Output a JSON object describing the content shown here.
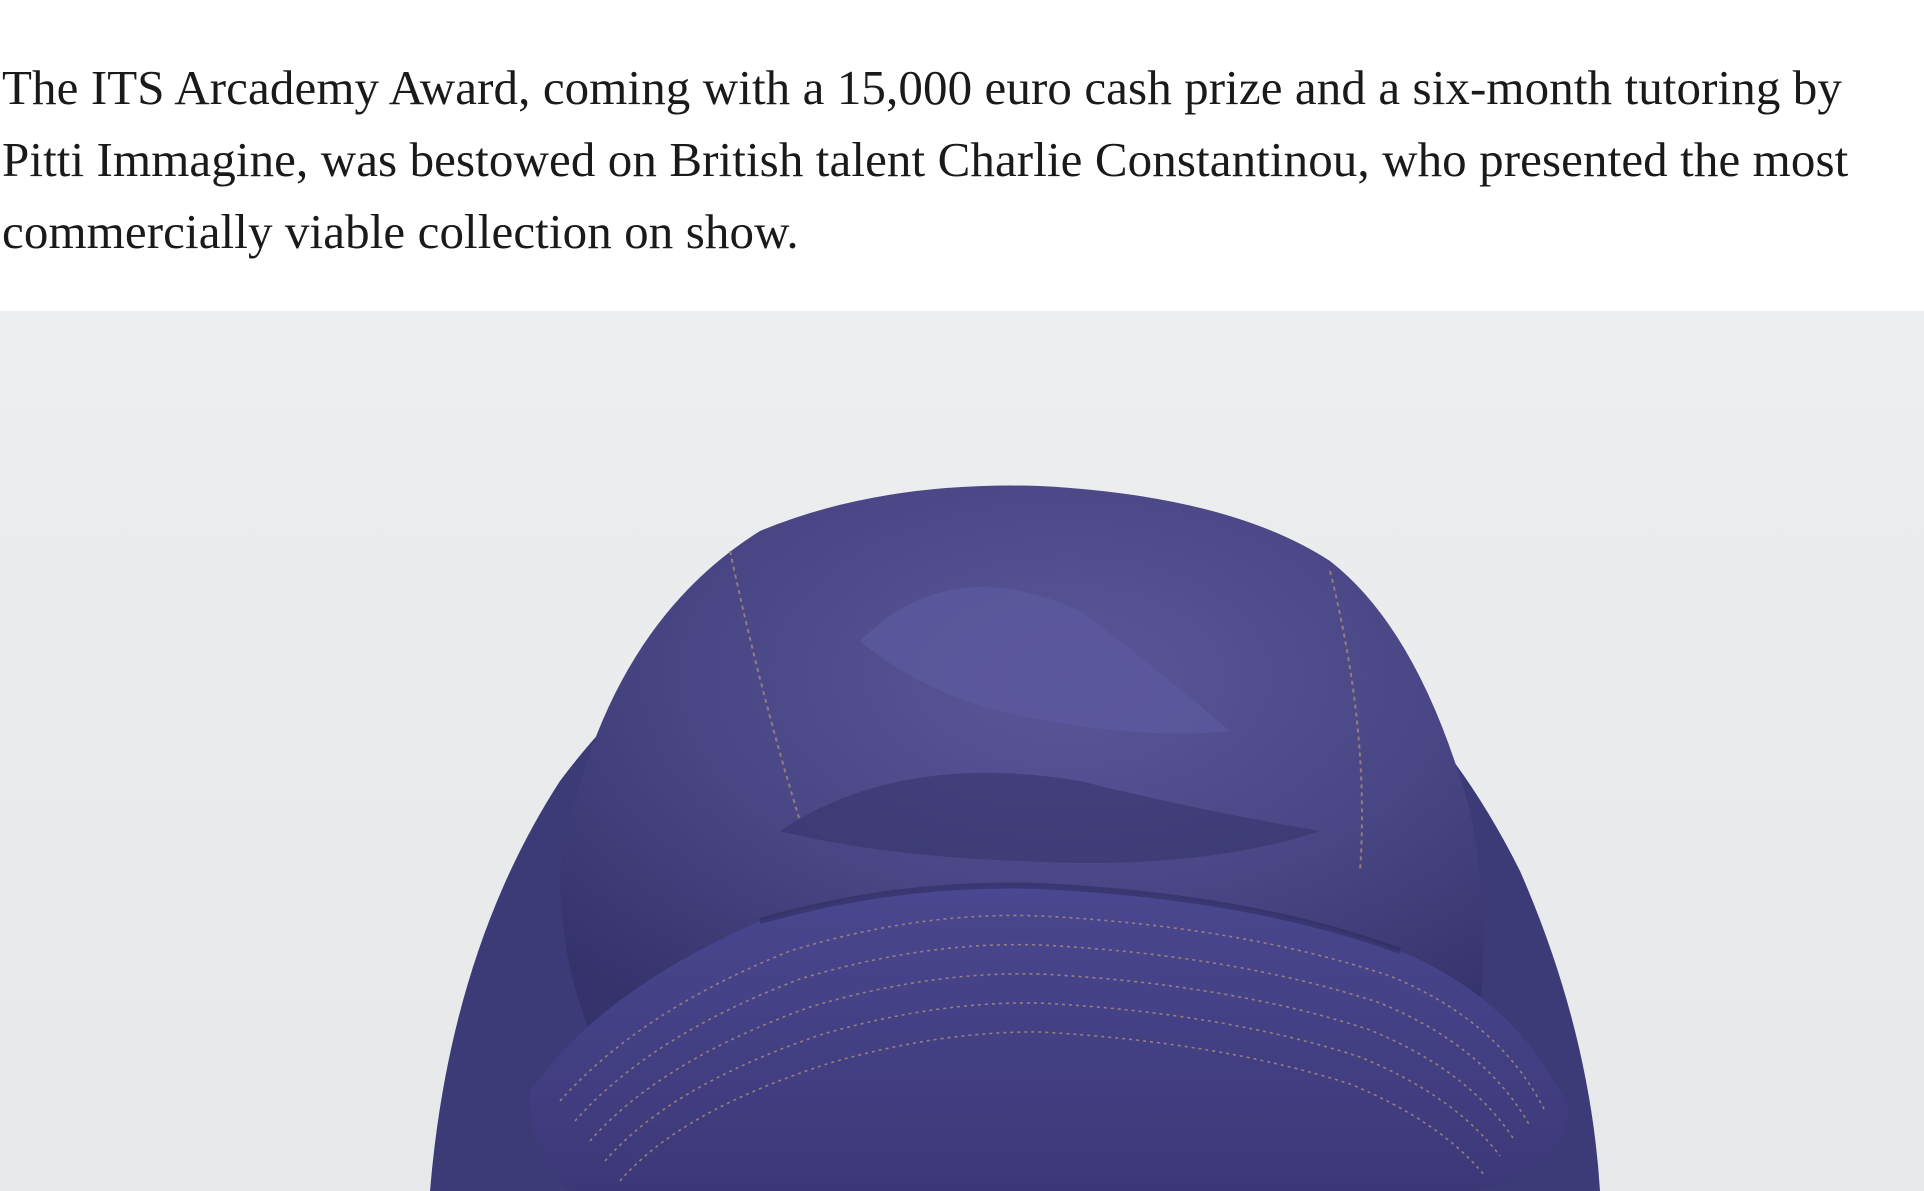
{
  "article": {
    "paragraph": "The ITS Arcademy Award, coming with a 15,000 euro cash prize and a six-month tutoring by Pitti Immagine, was bestowed on British talent Charlie Constantinou, who presented the most commercially viable collection on show."
  },
  "photo": {
    "subject": "purple bucket hat",
    "colors": {
      "background": "#eceef0",
      "hat_main": "#4a4685",
      "hat_dark": "#2f2c63",
      "hat_highlight": "#6a66a8",
      "stitching": "#a48a7c",
      "hair": "#5a4a2e"
    }
  }
}
